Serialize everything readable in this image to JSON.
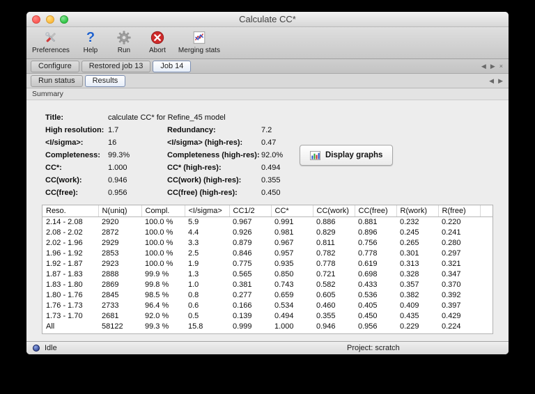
{
  "window": {
    "title": "Calculate CC*"
  },
  "toolbar": {
    "items": [
      {
        "label": "Preferences"
      },
      {
        "label": "Help"
      },
      {
        "label": "Run"
      },
      {
        "label": "Abort"
      },
      {
        "label": "Merging stats"
      }
    ]
  },
  "tabs": {
    "items": [
      {
        "label": "Configure",
        "active": false
      },
      {
        "label": "Restored job 13",
        "active": false
      },
      {
        "label": "Job 14",
        "active": true
      }
    ],
    "nav_left": "◀",
    "nav_right": "▶",
    "nav_close": "×"
  },
  "subtabs": {
    "items": [
      {
        "label": "Run status",
        "active": false
      },
      {
        "label": "Results",
        "active": true
      }
    ],
    "nav_left": "◀",
    "nav_right": "▶"
  },
  "section": {
    "label": "Summary"
  },
  "summary": {
    "rows": [
      {
        "label1": "Title:",
        "value1": "calculate CC* for Refine_45 model",
        "label2": "",
        "value2": ""
      },
      {
        "label1": "High resolution:",
        "value1": "1.7",
        "label2": "Redundancy:",
        "value2": "7.2"
      },
      {
        "label1": "<I/sigma>:",
        "value1": "16",
        "label2": "<I/sigma> (high-res):",
        "value2": "0.47"
      },
      {
        "label1": "Completeness:",
        "value1": "99.3%",
        "label2": "Completeness (high-res):",
        "value2": "92.0%"
      },
      {
        "label1": "CC*:",
        "value1": "1.000",
        "label2": "CC* (high-res):",
        "value2": "0.494"
      },
      {
        "label1": "CC(work):",
        "value1": "0.946",
        "label2": "CC(work) (high-res):",
        "value2": "0.355"
      },
      {
        "label1": "CC(free):",
        "value1": "0.956",
        "label2": "CC(free) (high-res):",
        "value2": "0.450"
      }
    ],
    "display_graphs": "Display graphs"
  },
  "table": {
    "columns": [
      "Reso.",
      "N(uniq)",
      "Compl.",
      "<I/sigma>",
      "CC1/2",
      "CC*",
      "CC(work)",
      "CC(free)",
      "R(work)",
      "R(free)"
    ],
    "rows": [
      {
        "reso": "2.14 - 2.08",
        "nuniq": "2920",
        "compl": "100.0 %",
        "isigma": "5.9",
        "cc12": "0.967",
        "ccstar": "0.991",
        "ccwork": "0.886",
        "ccfree": "0.881",
        "rwork": "0.232",
        "rfree": "0.220"
      },
      {
        "reso": "2.08 - 2.02",
        "nuniq": "2872",
        "compl": "100.0 %",
        "isigma": "4.4",
        "cc12": "0.926",
        "ccstar": "0.981",
        "ccwork": "0.829",
        "ccfree": "0.896",
        "rwork": "0.245",
        "rfree": "0.241"
      },
      {
        "reso": "2.02 - 1.96",
        "nuniq": "2929",
        "compl": "100.0 %",
        "isigma": "3.3",
        "cc12": "0.879",
        "ccstar": "0.967",
        "ccwork": "0.811",
        "ccfree": "0.756",
        "rwork": "0.265",
        "rfree": "0.280"
      },
      {
        "reso": "1.96 - 1.92",
        "nuniq": "2853",
        "compl": "100.0 %",
        "isigma": "2.5",
        "cc12": "0.846",
        "ccstar": "0.957",
        "ccwork": "0.782",
        "ccfree": "0.778",
        "rwork": "0.301",
        "rfree": "0.297"
      },
      {
        "reso": "1.92 - 1.87",
        "nuniq": "2923",
        "compl": "100.0 %",
        "isigma": "1.9",
        "cc12": "0.775",
        "ccstar": "0.935",
        "ccwork": "0.778",
        "ccfree": "0.619",
        "rwork": "0.313",
        "rfree": "0.321"
      },
      {
        "reso": "1.87 - 1.83",
        "nuniq": "2888",
        "compl": "99.9 %",
        "isigma": "1.3",
        "cc12": "0.565",
        "ccstar": "0.850",
        "ccwork": "0.721",
        "ccfree": "0.698",
        "rwork": "0.328",
        "rfree": "0.347"
      },
      {
        "reso": "1.83 - 1.80",
        "nuniq": "2869",
        "compl": "99.8 %",
        "isigma": "1.0",
        "cc12": "0.381",
        "ccstar": "0.743",
        "ccwork": "0.582",
        "ccfree": "0.433",
        "rwork": "0.357",
        "rfree": "0.370"
      },
      {
        "reso": "1.80 - 1.76",
        "nuniq": "2845",
        "compl": "98.5 %",
        "isigma": "0.8",
        "cc12": "0.277",
        "ccstar": "0.659",
        "ccwork": "0.605",
        "ccfree": "0.536",
        "rwork": "0.382",
        "rfree": "0.392"
      },
      {
        "reso": "1.76 - 1.73",
        "nuniq": "2733",
        "compl": "96.4 %",
        "isigma": "0.6",
        "cc12": "0.166",
        "ccstar": "0.534",
        "ccwork": "0.460",
        "ccfree": "0.405",
        "rwork": "0.409",
        "rfree": "0.397"
      },
      {
        "reso": "1.73 - 1.70",
        "nuniq": "2681",
        "compl": "92.0 %",
        "isigma": "0.5",
        "cc12": "0.139",
        "ccstar": "0.494",
        "ccwork": "0.355",
        "ccfree": "0.450",
        "rwork": "0.435",
        "rfree": "0.429"
      },
      {
        "reso": "All",
        "nuniq": "58122",
        "compl": "99.3 %",
        "isigma": "15.8",
        "cc12": "0.999",
        "ccstar": "1.000",
        "ccwork": "0.946",
        "ccfree": "0.956",
        "rwork": "0.229",
        "rfree": "0.224"
      }
    ]
  },
  "statusbar": {
    "status": "Idle",
    "project": "Project: scratch"
  }
}
